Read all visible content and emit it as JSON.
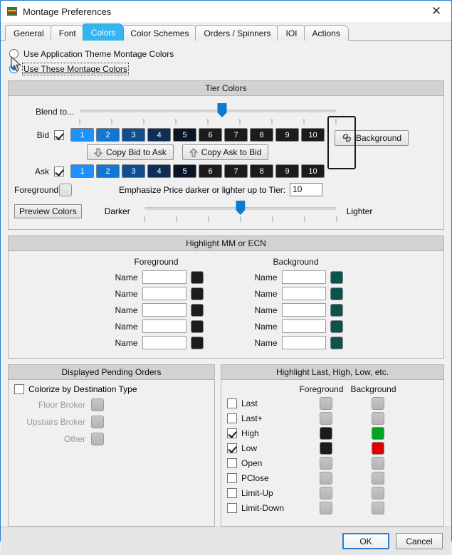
{
  "window": {
    "title": "Montage Preferences",
    "icon": "montage-stripes-icon",
    "close_label": "✕",
    "border_color": "#2d7dd2"
  },
  "tabs": [
    {
      "label": "General",
      "active": false
    },
    {
      "label": "Font",
      "active": false
    },
    {
      "label": "Colors",
      "active": true
    },
    {
      "label": "Color Schemes",
      "active": false
    },
    {
      "label": "Orders / Spinners",
      "active": false
    },
    {
      "label": "IOI",
      "active": false
    },
    {
      "label": "Actions",
      "active": false
    }
  ],
  "mode_options": [
    {
      "label": "Use Application Theme Montage Colors",
      "checked": false,
      "focused": false
    },
    {
      "label": "Use These Montage Colors",
      "checked": true,
      "focused": true
    }
  ],
  "tier_colors": {
    "title": "Tier Colors",
    "blend_label": "Blend to...",
    "blend_slider": {
      "value": 6,
      "min": 1,
      "max": 10,
      "ticks": 9
    },
    "bid": {
      "label": "Bid",
      "checked": true,
      "tiers": [
        {
          "n": "1",
          "color": "#1e90ff"
        },
        {
          "n": "2",
          "color": "#1276d6"
        },
        {
          "n": "3",
          "color": "#0f4f91"
        },
        {
          "n": "4",
          "color": "#0d2f57"
        },
        {
          "n": "5",
          "color": "#0a1526"
        },
        {
          "n": "6",
          "color": "#1c1c1c"
        },
        {
          "n": "7",
          "color": "#1c1c1c"
        },
        {
          "n": "8",
          "color": "#1c1c1c"
        },
        {
          "n": "9",
          "color": "#1c1c1c"
        },
        {
          "n": "10",
          "color": "#1c1c1c"
        }
      ]
    },
    "ask": {
      "label": "Ask",
      "checked": true,
      "tiers": [
        {
          "n": "1",
          "color": "#1e90ff"
        },
        {
          "n": "2",
          "color": "#1276d6"
        },
        {
          "n": "3",
          "color": "#0f4f91"
        },
        {
          "n": "4",
          "color": "#0d2f57"
        },
        {
          "n": "5",
          "color": "#0a1526"
        },
        {
          "n": "6",
          "color": "#1c1c1c"
        },
        {
          "n": "7",
          "color": "#1c1c1c"
        },
        {
          "n": "8",
          "color": "#1c1c1c"
        },
        {
          "n": "9",
          "color": "#1c1c1c"
        },
        {
          "n": "10",
          "color": "#1c1c1c"
        }
      ]
    },
    "copy_bid_to_ask": "Copy Bid to Ask",
    "copy_ask_to_bid": "Copy Ask to Bid",
    "background_button": "Background",
    "foreground_label": "Foreground",
    "foreground_swatch": "#e4e4e4",
    "emphasize_label": "Emphasize Price darker or lighter up to Tier:",
    "emphasize_value": "10",
    "preview_colors": "Preview Colors",
    "darker_label": "Darker",
    "lighter_label": "Lighter",
    "emphasis_slider": {
      "value": 4,
      "min": 1,
      "max": 7,
      "ticks": 7
    }
  },
  "highlight_mm": {
    "title": "Highlight MM or ECN",
    "foreground_header": "Foreground",
    "background_header": "Background",
    "name_label": "Name",
    "rows": 5,
    "foreground_value": "",
    "background_value": "",
    "foreground_swatch": "#1c1c1c",
    "background_swatch": "#0c5350"
  },
  "pending_orders": {
    "title": "Displayed Pending Orders",
    "colorize_label": "Colorize by Destination Type",
    "colorize_checked": false,
    "rows": [
      {
        "label": "Floor Broker",
        "swatch": "#bdbdbd",
        "enabled": false
      },
      {
        "label": "Upstairs Broker",
        "swatch": "#bdbdbd",
        "enabled": false
      },
      {
        "label": "Other",
        "swatch": "#bdbdbd",
        "enabled": false
      }
    ]
  },
  "highlight_last": {
    "title": "Highlight Last, High, Low, etc.",
    "foreground_header": "Foreground",
    "background_header": "Background",
    "rows": [
      {
        "label": "Last",
        "checked": false,
        "fg": "#bdbdbd",
        "bg": "#bdbdbd",
        "enabled": false
      },
      {
        "label": "Last+",
        "checked": false,
        "fg": "#bdbdbd",
        "bg": "#bdbdbd",
        "enabled": false
      },
      {
        "label": "High",
        "checked": true,
        "fg": "#1c1c1c",
        "bg": "#00a61f",
        "enabled": true
      },
      {
        "label": "Low",
        "checked": true,
        "fg": "#1c1c1c",
        "bg": "#e00000",
        "enabled": true
      },
      {
        "label": "Open",
        "checked": false,
        "fg": "#bdbdbd",
        "bg": "#bdbdbd",
        "enabled": false
      },
      {
        "label": "PClose",
        "checked": false,
        "fg": "#bdbdbd",
        "bg": "#bdbdbd",
        "enabled": false
      },
      {
        "label": "Limit-Up",
        "checked": false,
        "fg": "#bdbdbd",
        "bg": "#bdbdbd",
        "enabled": false
      },
      {
        "label": "Limit-Down",
        "checked": false,
        "fg": "#bdbdbd",
        "bg": "#bdbdbd",
        "enabled": false
      }
    ]
  },
  "footer": {
    "ok_label": "OK",
    "cancel_label": "Cancel"
  }
}
